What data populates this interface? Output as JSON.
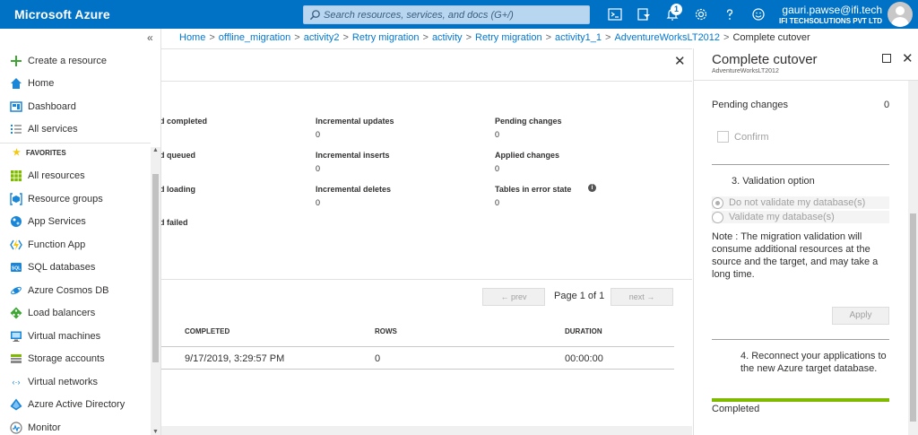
{
  "topbar": {
    "brand": "Microsoft Azure",
    "search_placeholder": "Search resources, services, and docs (G+/)",
    "notification_count": "1",
    "user_email": "gauri.pawse@ifi.tech",
    "user_org": "IFI TECHSOLUTIONS PVT LTD",
    "icons": [
      "cloud-shell-icon",
      "directory-filter-icon",
      "notifications-icon",
      "settings-icon",
      "help-icon",
      "feedback-icon"
    ]
  },
  "sidebar": {
    "collapse_glyph": "«",
    "top_items": [
      {
        "label": "Create a resource",
        "icon": "plus-icon"
      },
      {
        "label": "Home",
        "icon": "home-icon"
      },
      {
        "label": "Dashboard",
        "icon": "dashboard-icon"
      },
      {
        "label": "All services",
        "icon": "list-icon"
      }
    ],
    "favorites_label": "FAVORITES",
    "favorite_items": [
      {
        "label": "All resources",
        "icon": "grid-icon"
      },
      {
        "label": "Resource groups",
        "icon": "resource-group-icon"
      },
      {
        "label": "App Services",
        "icon": "app-services-icon"
      },
      {
        "label": "Function App",
        "icon": "function-app-icon"
      },
      {
        "label": "SQL databases",
        "icon": "sql-icon"
      },
      {
        "label": "Azure Cosmos DB",
        "icon": "cosmos-icon"
      },
      {
        "label": "Load balancers",
        "icon": "load-balancer-icon"
      },
      {
        "label": "Virtual machines",
        "icon": "vm-icon"
      },
      {
        "label": "Storage accounts",
        "icon": "storage-icon"
      },
      {
        "label": "Virtual networks",
        "icon": "vnet-icon"
      },
      {
        "label": "Azure Active Directory",
        "icon": "aad-icon"
      },
      {
        "label": "Monitor",
        "icon": "monitor-icon"
      }
    ]
  },
  "breadcrumb": {
    "links": [
      "Home",
      "offline_migration",
      "activity2",
      "Retry migration",
      "activity",
      "Retry migration",
      "activity1_1",
      "AdventureWorksLT2012"
    ],
    "current": "Complete cutover",
    "separator": ">"
  },
  "main": {
    "stats": [
      {
        "label": "d completed",
        "value": ""
      },
      {
        "label": "d queued",
        "value": ""
      },
      {
        "label": "d loading",
        "value": ""
      },
      {
        "label": "d failed",
        "value": ""
      },
      {
        "label": "Incremental updates",
        "value": "0"
      },
      {
        "label": "Incremental inserts",
        "value": "0"
      },
      {
        "label": "Incremental deletes",
        "value": "0"
      },
      {
        "label": "Pending changes",
        "value": "0"
      },
      {
        "label": "Applied changes",
        "value": "0"
      },
      {
        "label": "Tables in error state",
        "value": "0"
      }
    ],
    "pagination": {
      "prev": "← prev",
      "page_info": "Page 1 of 1",
      "next": "next →"
    },
    "table": {
      "headers": [
        "COMPLETED",
        "ROWS",
        "DURATION"
      ],
      "rows": [
        [
          "9/17/2019, 3:29:57 PM",
          "0",
          "00:00:00"
        ]
      ]
    }
  },
  "cutover": {
    "title": "Complete cutover",
    "subtitle": "AdventureWorksLT2012",
    "pending_label": "Pending changes",
    "pending_value": "0",
    "confirm_label": "Confirm",
    "step3_label": "3. Validation option",
    "radio_options": [
      "Do not validate my database(s)",
      "Validate my database(s)"
    ],
    "selected_radio": 0,
    "note": "Note : The migration validation will consume additional resources at the source and the target, and may take a long time.",
    "apply_label": "Apply",
    "step4_label": "4. Reconnect your applications to the new Azure target database.",
    "progress": 1.0,
    "status": "Completed",
    "progress_color": "#7fba00"
  },
  "colors": {
    "brand": "#0072c6",
    "link": "#0078d4"
  }
}
